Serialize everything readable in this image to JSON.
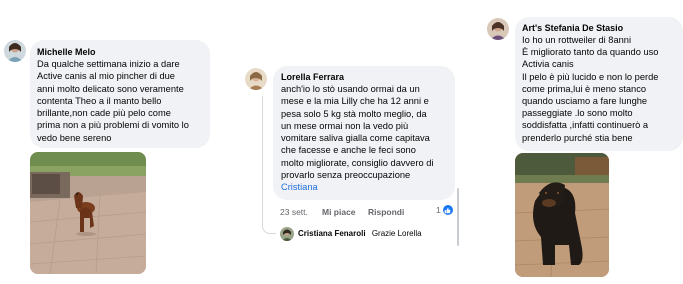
{
  "comments": [
    {
      "author": "Michelle Melo",
      "text": "Da qualche settimana inizio a dare\nActive canis al mio pincher di due\nanni molto delicato sono veramente\ncontenta Theo a il manto bello\nbrillante,non cade più pelo come\nprima non a più problemi di vomito lo\nvedo bene sereno",
      "avatar_icon": "woman-profile-avatar",
      "photo_icon": "dog-on-pavement-photo"
    },
    {
      "author": "Lorella Ferrara",
      "text": "anch'io lo stò usando ormai da un\nmese e la mia Lilly che ha 12 anni e\npesa solo 5 kg stà molto meglio, da\nun mese ormai non la vedo più\nvomitare saliva gialla come capitava\nche facesse e anche le feci sono\nmolto migliorate, consiglio davvero di\nprovarlo senza preoccupazione",
      "mention": "Cristiana",
      "avatar_icon": "woman-profile-avatar",
      "photo_icon": "small-dog-in-garden-photo",
      "time": "23 sett.",
      "like_label": "Mi piace",
      "reply_label": "Rispondi",
      "reaction_count": "1",
      "reaction_icon": "thumbs-up-icon",
      "reply_item": {
        "author": "Cristiana Fenaroli",
        "text": "Grazie Lorella"
      }
    },
    {
      "author": "Art's Stefania De Stasio",
      "text": "Io ho un rottweiler di 8anni\nÈ migliorato tanto da quando uso\nActivia canis\nIl pelo è più lucido e non lo perde\ncome prima,lui è meno stanco\nquando usciamo a fare lunghe\npasseggiate .lo sono molto\nsoddisfatta ,infatti continuerò a\nprenderlo purché stia bene",
      "avatar_icon": "woman-profile-avatar",
      "photo_icon": "rottweiler-in-garden-photo"
    }
  ],
  "colors": {
    "bubble": "#f0f2f5",
    "text": "#050505",
    "meta": "#65676b",
    "mention": "#216fdb",
    "like": "#1877f2"
  }
}
